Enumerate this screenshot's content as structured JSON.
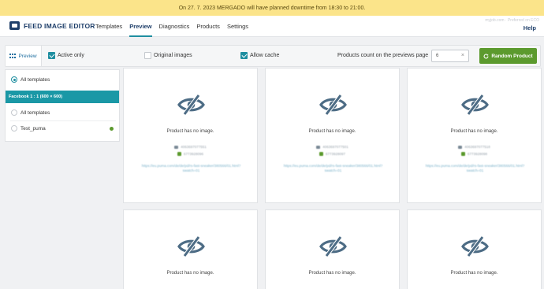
{
  "banner": {
    "text": "On 27. 7. 2023 MERGADO will have planned downtime from 18:30 to 21:00."
  },
  "header": {
    "app_title": "FEED IMAGE EDITOR",
    "nav": [
      "Templates",
      "Preview",
      "Diagnostics",
      "Products",
      "Settings"
    ],
    "active_nav": "Preview",
    "right_top": "myjob.com · Preferred on ECO",
    "help": "Help"
  },
  "toolbar": {
    "preview_tab": "Preview",
    "active_only": {
      "label": "Active only",
      "checked": true
    },
    "original_images": {
      "label": "Original images",
      "checked": false
    },
    "allow_cache": {
      "label": "Allow cache",
      "checked": true
    },
    "products_count_label": "Products count on the previews page",
    "products_count_value": "6",
    "clear_icon": "×",
    "random_button": "Random Product"
  },
  "sidebar": {
    "all_templates_top": "All templates",
    "group_header": "Facebook 1 : 1 (600 × 600)",
    "items": [
      {
        "label": "All templates",
        "selected": false,
        "dot": false
      },
      {
        "label": "Test_puma",
        "selected": false,
        "dot": true
      }
    ]
  },
  "cards": [
    {
      "no_image": "Product has no image.",
      "id1": "4063697077551",
      "id2": "6773928096",
      "url": "https://eu.puma.com/de/de/pd/rs-fast-sneaker/380566/01.html?swatch=01"
    },
    {
      "no_image": "Product has no image.",
      "id1": "4063697077501",
      "id2": "6773928097",
      "url": "https://eu.puma.com/de/de/pd/rs-fast-sneaker/380566/01.html?swatch=01"
    },
    {
      "no_image": "Product has no image.",
      "id1": "4063697077518",
      "id2": "6773928098",
      "url": "https://eu.puma.com/de/de/pd/rs-fast-sneaker/380566/01.html?swatch=01"
    },
    {
      "no_image": "Product has no image."
    },
    {
      "no_image": "Product has no image."
    },
    {
      "no_image": "Product has no image."
    }
  ],
  "colors": {
    "accent": "#1a98a6",
    "brand": "#1f3f6a",
    "green": "#5c9a2e",
    "banner": "#fbe48a"
  }
}
